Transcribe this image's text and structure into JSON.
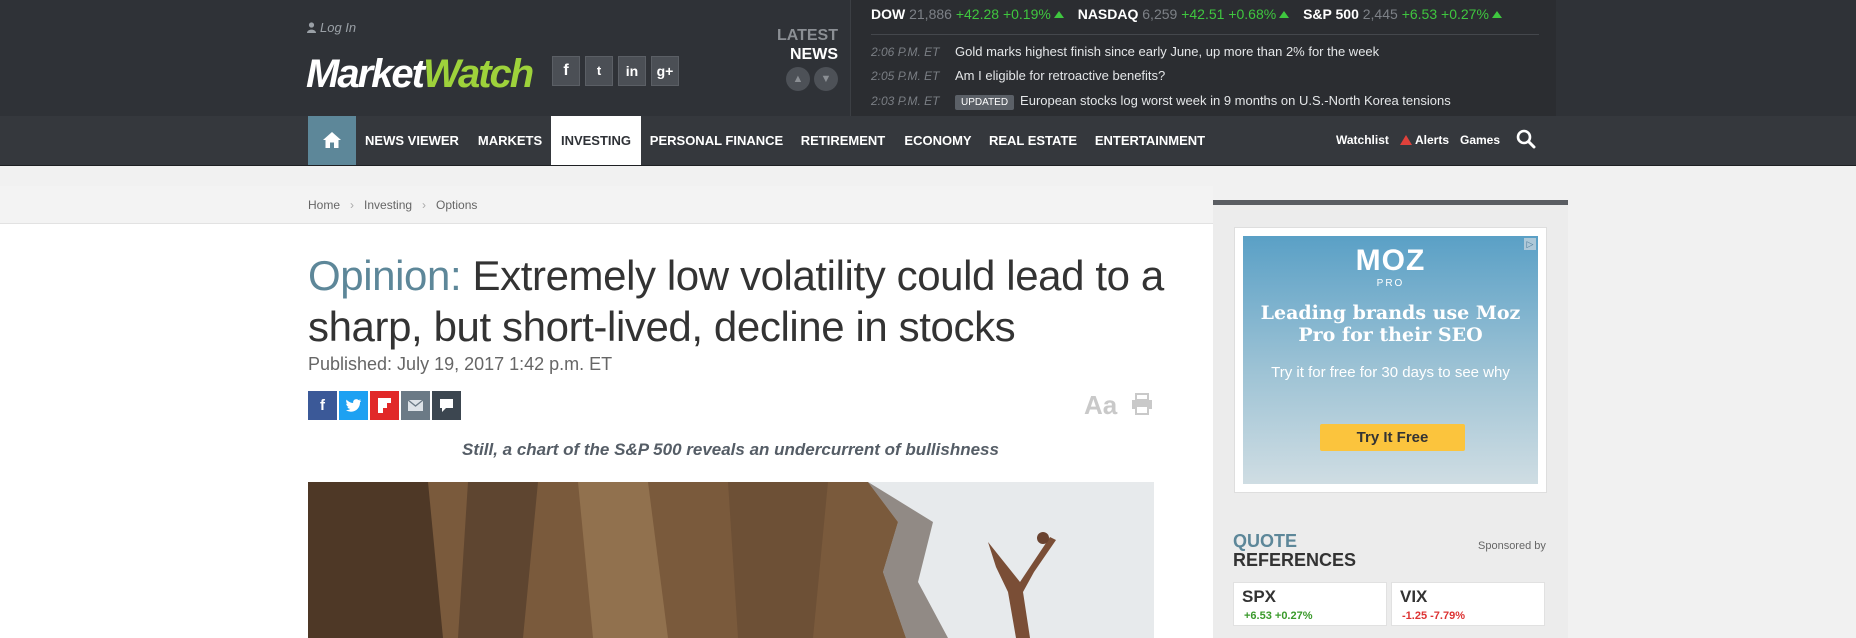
{
  "header": {
    "login_label": "Log In",
    "logo_part1": "Market",
    "logo_part2": "Watch",
    "social": [
      "f",
      "t",
      "in",
      "g+"
    ],
    "latest_label1": "LATEST",
    "latest_label2": "NEWS"
  },
  "markets": [
    {
      "name": "DOW",
      "value": "21,886",
      "change": "+42.28",
      "percent": "+0.19%"
    },
    {
      "name": "NASDAQ",
      "value": "6,259",
      "change": "+42.51",
      "percent": "+0.68%"
    },
    {
      "name": "S&P 500",
      "value": "2,445",
      "change": "+6.53",
      "percent": "+0.27%"
    }
  ],
  "news": [
    {
      "time": "2:06 P.M. ET",
      "headline": "Gold marks highest finish since early June, up more than 2% for the week"
    },
    {
      "time": "2:05 P.M. ET",
      "headline": "Am I eligible for retroactive benefits?"
    },
    {
      "time": "2:03 P.M. ET",
      "badge": "UPDATED",
      "headline": "European stocks log worst week in 9 months on U.S.-North Korea tensions"
    }
  ],
  "nav": {
    "items": [
      "NEWS VIEWER",
      "MARKETS",
      "INVESTING",
      "PERSONAL FINANCE",
      "RETIREMENT",
      "ECONOMY",
      "REAL ESTATE",
      "ENTERTAINMENT"
    ],
    "active": "INVESTING",
    "watchlist": "Watchlist",
    "alerts": "Alerts",
    "games": "Games"
  },
  "breadcrumb": [
    "Home",
    "Investing",
    "Options"
  ],
  "article": {
    "opinion_label": "Opinion:",
    "headline": " Extremely low volatility could lead to a sharp, but short-lived, decline in stocks",
    "published": "Published: July 19, 2017 1:42 p.m. ET",
    "subheadline": "Still, a chart of the S&P 500 reveals an undercurrent of bullishness",
    "text_size_label": "Aa",
    "share_buttons": [
      "facebook",
      "twitter",
      "flipboard",
      "email",
      "comments"
    ]
  },
  "ad": {
    "logo": "MOZ",
    "logo_sub": "PRO",
    "headline": "Leading brands use Moz Pro for their SEO",
    "sub": "Try it for free for 30 days to see why",
    "cta": "Try It Free"
  },
  "quotes": {
    "title1": "QUOTE",
    "title2": "REFERENCES",
    "sponsored": "Sponsored by",
    "items": [
      {
        "symbol": "SPX",
        "change": "+6.53 +0.27%"
      },
      {
        "symbol": "VIX",
        "change": "-1.25 -7.79%"
      }
    ]
  },
  "colors": {
    "accent": "#5d8799",
    "up": "#3fc63f",
    "down": "#dd3333",
    "header_bg": "#2f3237"
  }
}
